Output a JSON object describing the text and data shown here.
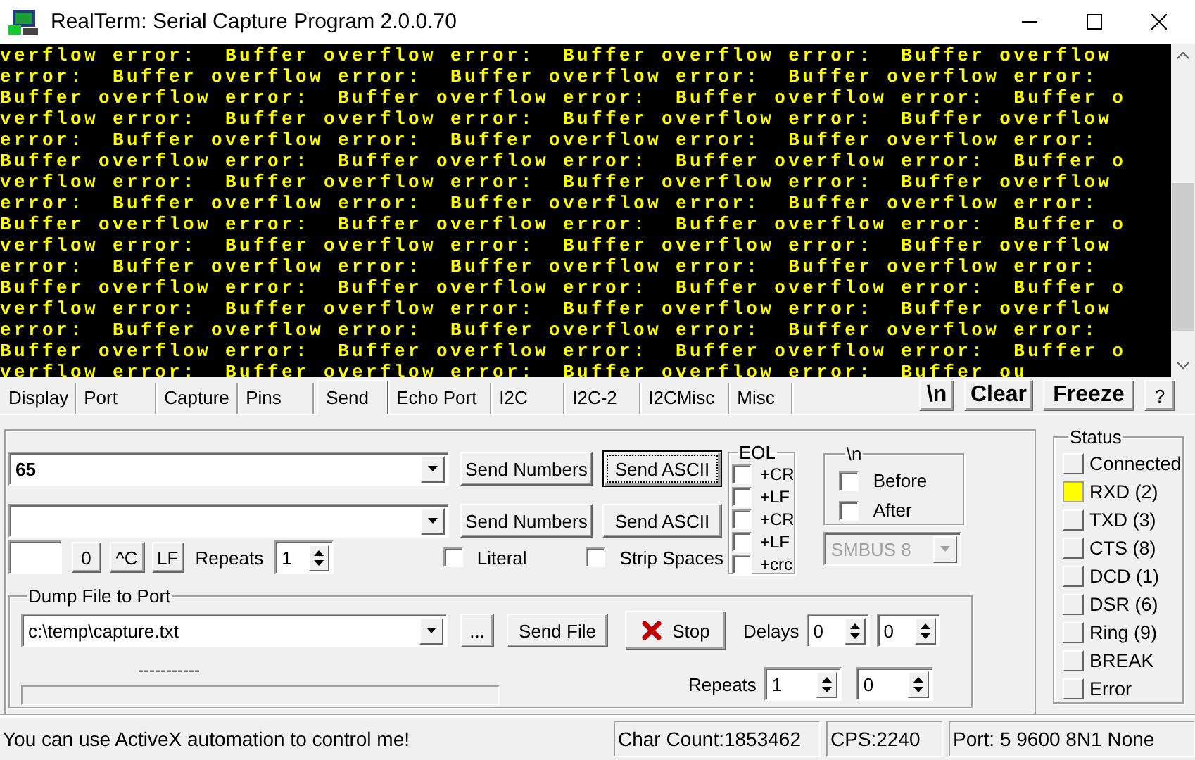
{
  "window": {
    "title": "RealTerm: Serial Capture Program 2.0.0.70"
  },
  "terminal": {
    "lines": [
      "verflow error:  Buffer overflow error:  Buffer overflow error:  Buffer overflow",
      "error:  Buffer overflow error:  Buffer overflow error:  Buffer overflow error:",
      "Buffer overflow error:  Buffer overflow error:  Buffer overflow error:  Buffer o",
      "verflow error:  Buffer overflow error:  Buffer overflow error:  Buffer overflow",
      "error:  Buffer overflow error:  Buffer overflow error:  Buffer overflow error:",
      "Buffer overflow error:  Buffer overflow error:  Buffer overflow error:  Buffer o",
      "verflow error:  Buffer overflow error:  Buffer overflow error:  Buffer overflow",
      "error:  Buffer overflow error:  Buffer overflow error:  Buffer overflow error:",
      "Buffer overflow error:  Buffer overflow error:  Buffer overflow error:  Buffer o",
      "verflow error:  Buffer overflow error:  Buffer overflow error:  Buffer overflow",
      "error:  Buffer overflow error:  Buffer overflow error:  Buffer overflow error:",
      "Buffer overflow error:  Buffer overflow error:  Buffer overflow error:  Buffer o",
      "verflow error:  Buffer overflow error:  Buffer overflow error:  Buffer overflow",
      "error:  Buffer overflow error:  Buffer overflow error:  Buffer overflow error:",
      "Buffer overflow error:  Buffer overflow error:  Buffer overflow error:  Buffer o",
      "verflow error:  Buffer overflow error:  Buffer overflow error:  Buffer ou"
    ]
  },
  "tabs": [
    {
      "label": "Display",
      "selected": false
    },
    {
      "label": "Port",
      "selected": false
    },
    {
      "label": "Capture",
      "selected": false
    },
    {
      "label": "Pins",
      "selected": false
    },
    {
      "label": "Send",
      "selected": true
    },
    {
      "label": "Echo Port",
      "selected": false
    },
    {
      "label": "I2C",
      "selected": false
    },
    {
      "label": "I2C-2",
      "selected": false
    },
    {
      "label": "I2CMisc",
      "selected": false
    },
    {
      "label": "Misc",
      "selected": false
    }
  ],
  "toolbar_buttons": [
    "\\n",
    "Clear",
    "Freeze",
    "?"
  ],
  "send": {
    "rows": [
      {
        "value": "65",
        "numbers_button": "Send Numbers",
        "ascii_button": "Send ASCII",
        "focused": true
      },
      {
        "numbers_button": "Send Numbers",
        "ascii_button": "Send ASCII",
        "focused": false
      }
    ],
    "quick_buttons": [
      "0",
      "^C",
      "LF"
    ],
    "repeats": {
      "label": "Repeats",
      "value": "1"
    },
    "options": [
      {
        "label": "Literal",
        "checked": false
      },
      {
        "label": "Strip Spaces",
        "checked": false
      }
    ],
    "eol": {
      "title": "EOL",
      "options": [
        {
          "label": "+CR",
          "checked": false
        },
        {
          "label": "+LF",
          "checked": false
        },
        {
          "label": "+CR",
          "checked": false
        },
        {
          "label": "+LF",
          "checked": false
        },
        {
          "label": "+crc",
          "checked": false
        }
      ]
    },
    "newline": {
      "title": "\\n",
      "options": [
        {
          "label": "Before",
          "checked": false
        },
        {
          "label": "After",
          "checked": false
        }
      ]
    },
    "smbus": {
      "value": "SMBUS 8",
      "disabled": true
    },
    "dump": {
      "title": "Dump File to Port",
      "file": "c:\\temp\\capture.txt",
      "browse_button": "...",
      "send_button": "Send File",
      "stop_button": "Stop",
      "progress_text": "-----------",
      "progress": {
        "level": 0
      },
      "delays": {
        "label": "Delays",
        "values": [
          "0",
          "0"
        ]
      },
      "repeats": {
        "label": "Repeats",
        "values": [
          "1",
          "0"
        ]
      }
    }
  },
  "status": {
    "title": "Status",
    "items": [
      {
        "label": "Connected",
        "on": false
      },
      {
        "label": "RXD (2)",
        "on": true
      },
      {
        "label": "TXD (3)",
        "on": false
      },
      {
        "label": "CTS (8)",
        "on": false
      },
      {
        "label": "DCD (1)",
        "on": false
      },
      {
        "label": "DSR (6)",
        "on": false
      },
      {
        "label": "Ring (9)",
        "on": false
      },
      {
        "label": "BREAK",
        "on": false
      },
      {
        "label": "Error",
        "on": false
      }
    ]
  },
  "status_bar": {
    "message": "You can use ActiveX automation to control me!",
    "char_count": "Char Count:1853462",
    "cps": "CPS:2240",
    "port": "Port: 5 9600 8N1 None"
  }
}
